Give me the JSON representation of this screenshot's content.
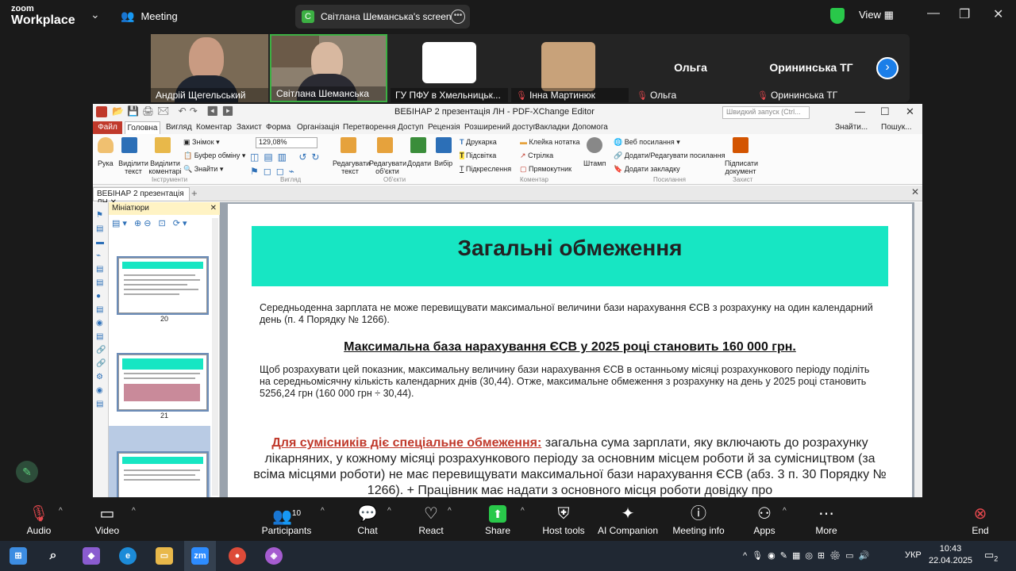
{
  "zoom": {
    "logo_line1": "zoom",
    "logo_line2": "Workplace",
    "meeting_label": "Meeting",
    "screen_label": "Світлана Шеманська's screen",
    "screen_initial": "С",
    "view_label": "View",
    "participants": [
      {
        "name": "Андрій Щегельський",
        "muted": false
      },
      {
        "name": "Світлана Шеманська",
        "muted": false
      },
      {
        "name": "ГУ ПФУ в Хмельницьк...",
        "muted": false
      },
      {
        "name": "Інна Мартинюк",
        "muted": true
      },
      {
        "name": "Ольга",
        "muted": true,
        "big": "Ольга"
      },
      {
        "name": "Орининська ТГ",
        "muted": true,
        "big": "Орининська ТГ"
      }
    ],
    "toolbar": {
      "audio": "Audio",
      "video": "Video",
      "participants": "Participants",
      "participants_count": "10",
      "chat": "Chat",
      "react": "React",
      "share": "Share",
      "host_tools": "Host tools",
      "ai_companion": "AI Companion",
      "meeting_info": "Meeting info",
      "apps": "Apps",
      "more": "More",
      "end": "End"
    }
  },
  "pdf": {
    "title": "ВЕБІНАР 2 презентація ЛН - PDF-XChange Editor",
    "search_placeholder": "Швидкий запуск (Ctrl...",
    "menu": [
      "Файл",
      "Головна",
      "Вигляд",
      "Коментар",
      "Захист",
      "Форма",
      "Організація",
      "Перетворення",
      "Доступ",
      "Рецензія",
      "Розширений доступ",
      "Закладки",
      "Допомога"
    ],
    "menu_right": [
      "Знайти...",
      "Пошук..."
    ],
    "ribbon": {
      "hand": "Рука",
      "select_text": "Виділити текст",
      "select_comments": "Виділити коментарі",
      "snapshot": "Знімок",
      "clipboard": "Буфер обміну",
      "find": "Знайти",
      "tools_group": "Інструменти",
      "zoom_value": "129,08%",
      "view_group": "Вигляд",
      "edit_text": "Редагувати текст",
      "edit_objects": "Редагувати об'єкти",
      "add": "Додати",
      "select": "Вибір",
      "objects_group": "Об'єкти",
      "typewriter": "Друкарка",
      "highlight": "Підсвітка",
      "underline": "Підкреслення",
      "sticky_note": "Клейка нотатка",
      "arrow": "Стрілка",
      "rectangle": "Прямокутник",
      "stamp": "Штамп",
      "comment_group": "Коментар",
      "web_links": "Веб посилання",
      "add_edit_links": "Додати/Редагувати посилання",
      "add_bookmark": "Додати закладку",
      "links_group": "Посилання",
      "sign_document": "Підписати документ",
      "protect_group": "Захист"
    },
    "doc_tab": "ВЕБІНАР 2 презентація ЛН",
    "thumbnails_label": "Мініатюри",
    "thumb_pages": [
      "20",
      "21"
    ],
    "slide": {
      "title": "Загальні обмеження",
      "para1": "Середньоденна зарплата не може перевищувати максимальної величини бази нарахування ЄСВ з розрахунку на один календарний день (п. 4 Порядку № 1266).",
      "max_base": "Максимальна база нарахування ЄСВ у 2025 році становить 160 000 грн.",
      "para2": "Щоб розрахувати цей показник, максимальну величину бази нарахування ЄСВ в останньому місяці розрахункового періоду поділіть на середньомісячну кількість календарних днів (30,44). Отже, максимальне обмеження з розрахунку на день у 2025 році становить 5256,24 грн (160 000 грн ÷ 30,44).",
      "special_red": "Для сумісників діє спеціальне обмеження:",
      "special_rest": " загальна сума зарплати, яку включають до розрахунку лікарняних, у кожному місяці розрахункового періоду за основним місцем роботи й за сумісництвом (за всіма місцями роботи) не має перевищувати максимальної бази нарахування ЄСВ (абз. 3 п. 30 Порядку № 1266). + Працівник має надати з основного місця роботи довідку про"
    }
  },
  "taskbar": {
    "lang": "УКР",
    "time": "10:43",
    "date": "22.04.2025",
    "notif": "2"
  }
}
